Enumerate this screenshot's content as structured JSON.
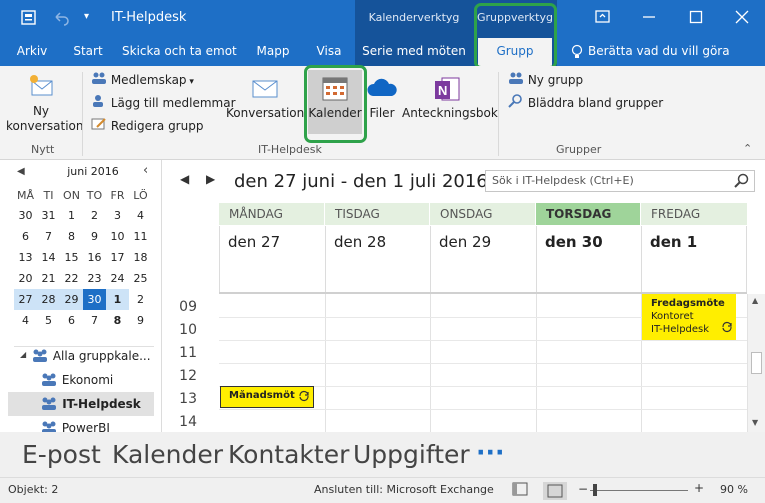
{
  "window": {
    "title": "IT-Helpdesk"
  },
  "context_headers": {
    "calendar_tools": "Kalenderverktyg",
    "group_tools": "Gruppverktyg"
  },
  "tabs": [
    "Arkiv",
    "Start",
    "Skicka och ta emot",
    "Mapp",
    "Visa",
    "Serie med möten",
    "Grupp"
  ],
  "tellme": "Berätta vad du vill göra",
  "ribbon": {
    "new_conversation": "Ny konversation",
    "membership": "Medlemskap",
    "add_members": "Lägg till medlemmar",
    "edit_group": "Redigera grupp",
    "conversations": "Konversationer",
    "calendar": "Kalender",
    "files": "Filer",
    "notebook": "Anteckningsbok",
    "new_group": "Ny grupp",
    "browse_groups": "Bläddra bland grupper",
    "group_new": "Nytt",
    "group_helpdesk": "IT-Helpdesk",
    "group_groups": "Grupper"
  },
  "minical": {
    "month": "juni 2016",
    "weekdays": [
      "MÅ",
      "TI",
      "ON",
      "TO",
      "FR",
      "LÖ"
    ],
    "weeks": [
      [
        "30",
        "31",
        "1",
        "2",
        "3",
        "4"
      ],
      [
        "6",
        "7",
        "8",
        "9",
        "10",
        "11"
      ],
      [
        "13",
        "14",
        "15",
        "16",
        "17",
        "18"
      ],
      [
        "20",
        "21",
        "22",
        "23",
        "24",
        "25"
      ],
      [
        "27",
        "28",
        "29",
        "30",
        "1",
        "2"
      ],
      [
        "4",
        "5",
        "6",
        "7",
        "8",
        "9"
      ]
    ]
  },
  "folders": {
    "all": "Alla gruppkale...",
    "items": [
      "Ekonomi",
      "IT-Helpdesk",
      "PowerBI"
    ]
  },
  "calendar": {
    "range": "den 27 juni - den 1 juli 2016",
    "search_placeholder": "Sök i IT-Helpdesk (Ctrl+E)",
    "days": [
      {
        "name": "MÅNDAG",
        "date": "den 27"
      },
      {
        "name": "TISDAG",
        "date": "den 28"
      },
      {
        "name": "ONSDAG",
        "date": "den 29"
      },
      {
        "name": "TORSDAG",
        "date": "den 30"
      },
      {
        "name": "FREDAG",
        "date": "den 1"
      }
    ],
    "hours": [
      "09",
      "10",
      "11",
      "12",
      "13",
      "14"
    ],
    "events": [
      {
        "title": "Fredagsmöte",
        "location": "Kontoret",
        "organizer": "IT-Helpdesk"
      },
      {
        "title": "Månadsmöte"
      }
    ]
  },
  "nav": [
    "E-post",
    "Kalender",
    "Kontakter",
    "Uppgifter",
    "···"
  ],
  "status": {
    "items": "Objekt: 2",
    "connection": "Ansluten till: Microsoft Exchange",
    "zoom": "90 %"
  },
  "colors": {
    "accent": "#1e6fc6",
    "today": "#9fd49a",
    "event": "#ffee00",
    "highlight": "#2ea24a"
  }
}
